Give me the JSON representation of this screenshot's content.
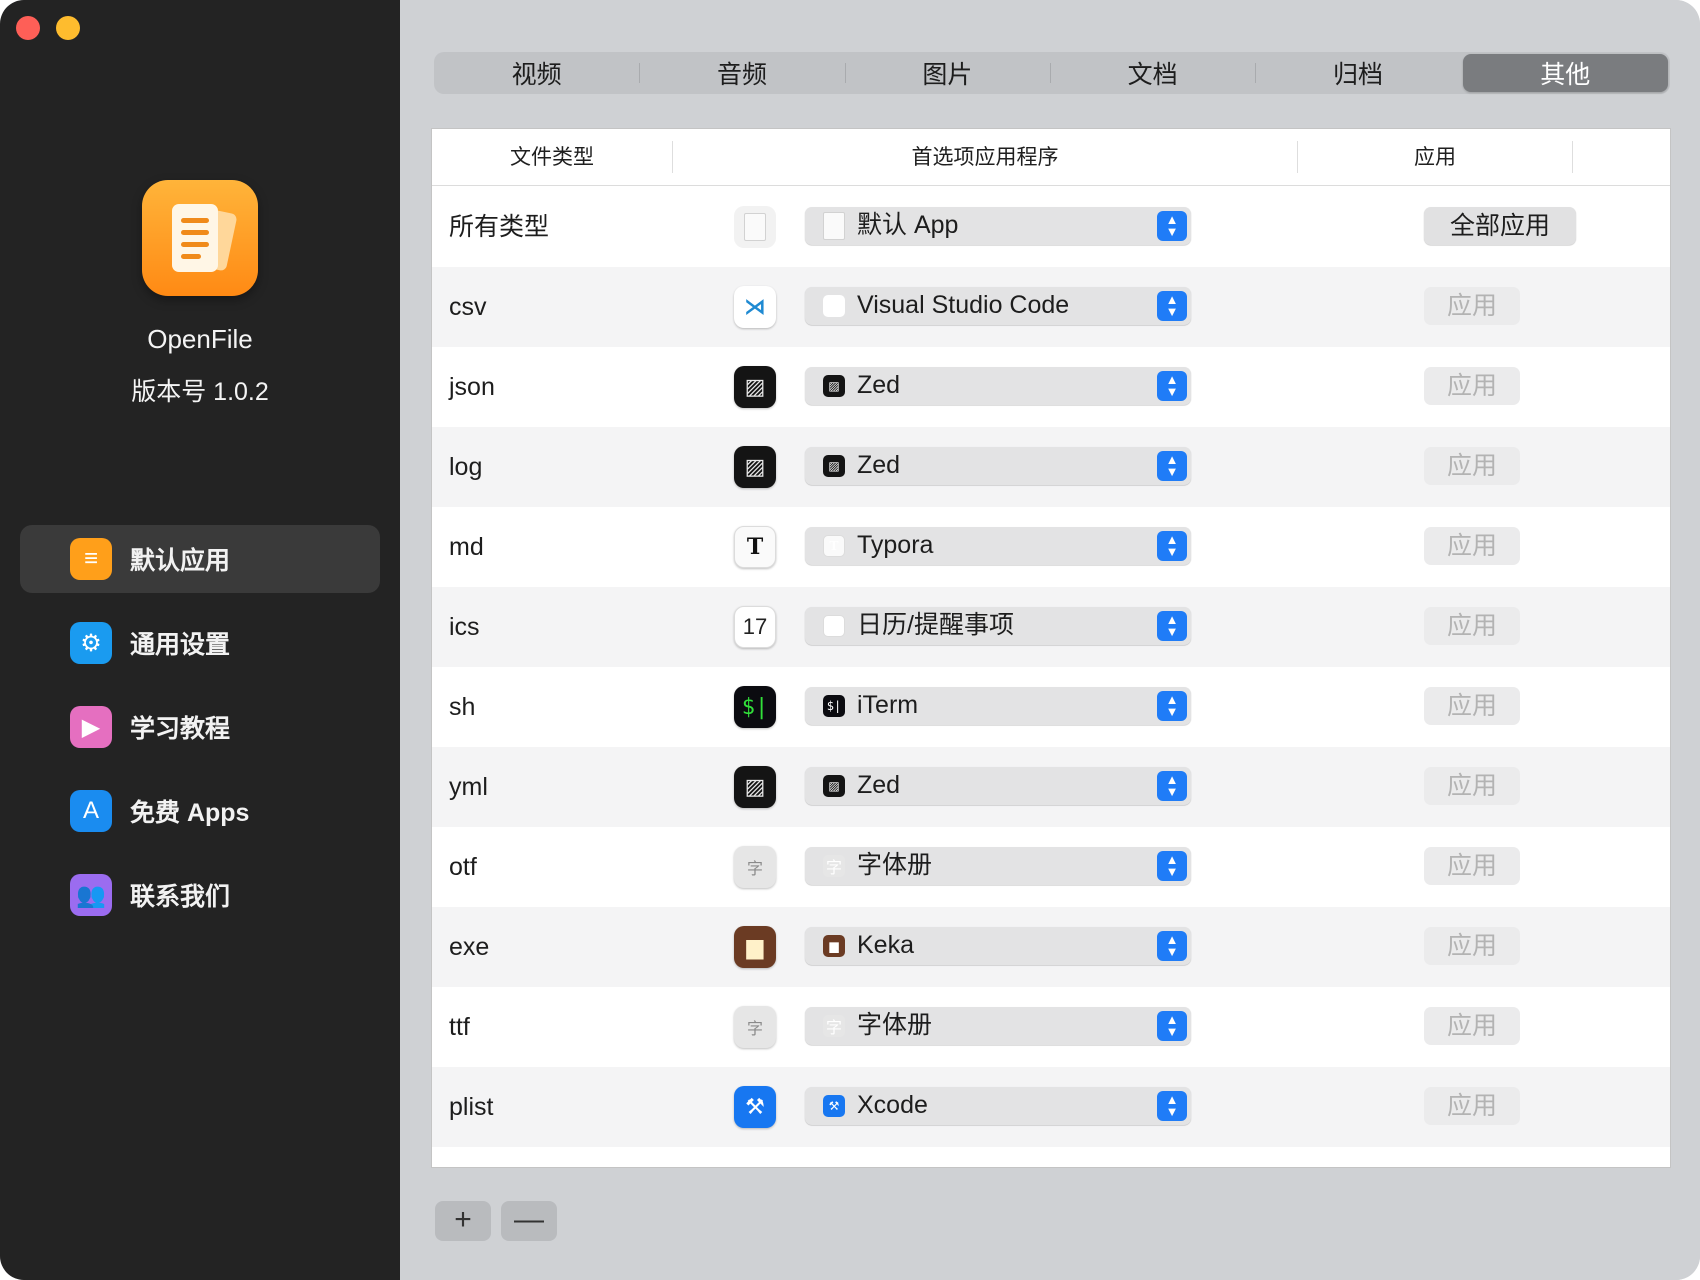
{
  "sidebar": {
    "app_name": "OpenFile",
    "version": "版本号 1.0.2",
    "items": [
      {
        "label": "默认应用",
        "icon": "document-icon",
        "color": "#ff9f1a",
        "glyph": "≡",
        "active": true
      },
      {
        "label": "通用设置",
        "icon": "gear-icon",
        "color": "#1a9bf0",
        "glyph": "⚙",
        "active": false
      },
      {
        "label": "学习教程",
        "icon": "video-icon",
        "color": "#e56fc0",
        "glyph": "▶",
        "active": false
      },
      {
        "label": "免费 Apps",
        "icon": "app-store-icon",
        "color": "#1a8cf0",
        "glyph": "A",
        "active": false
      },
      {
        "label": "联系我们",
        "icon": "people-icon",
        "color": "#9b6cf0",
        "glyph": "👥",
        "active": false
      }
    ]
  },
  "tabs": [
    {
      "label": "视频",
      "active": false
    },
    {
      "label": "音频",
      "active": false
    },
    {
      "label": "图片",
      "active": false
    },
    {
      "label": "文档",
      "active": false
    },
    {
      "label": "归档",
      "active": false
    },
    {
      "label": "其他",
      "active": true
    }
  ],
  "table": {
    "headers": {
      "type": "文件类型",
      "app": "首选项应用程序",
      "apply": "应用"
    },
    "rows": [
      {
        "type": "所有类型",
        "app": "默认 App",
        "icon": "blank-document-icon",
        "icon_class": "ic-blank",
        "glyph": "",
        "action": "全部应用",
        "action_kind": "all"
      },
      {
        "type": "csv",
        "app": "Visual Studio Code",
        "icon": "vscode-icon",
        "icon_class": "ic-vscode",
        "glyph": "⋊",
        "action": "应用",
        "action_kind": "single"
      },
      {
        "type": "json",
        "app": "Zed",
        "icon": "zed-icon",
        "icon_class": "ic-zed",
        "glyph": "▨",
        "action": "应用",
        "action_kind": "single"
      },
      {
        "type": "log",
        "app": "Zed",
        "icon": "zed-icon",
        "icon_class": "ic-zed",
        "glyph": "▨",
        "action": "应用",
        "action_kind": "single"
      },
      {
        "type": "md",
        "app": "Typora",
        "icon": "typora-icon",
        "icon_class": "ic-typora",
        "glyph": "T",
        "action": "应用",
        "action_kind": "single"
      },
      {
        "type": "ics",
        "app": "日历/提醒事项",
        "icon": "calendar-icon",
        "icon_class": "ic-cal",
        "glyph": "17",
        "action": "应用",
        "action_kind": "single"
      },
      {
        "type": "sh",
        "app": "iTerm",
        "icon": "iterm-icon",
        "icon_class": "ic-iterm",
        "glyph": "$|",
        "action": "应用",
        "action_kind": "single"
      },
      {
        "type": "yml",
        "app": "Zed",
        "icon": "zed-icon",
        "icon_class": "ic-zed",
        "glyph": "▨",
        "action": "应用",
        "action_kind": "single"
      },
      {
        "type": "otf",
        "app": "字体册",
        "icon": "font-book-icon",
        "icon_class": "ic-font",
        "glyph": "字",
        "action": "应用",
        "action_kind": "single"
      },
      {
        "type": "exe",
        "app": "Keka",
        "icon": "keka-icon",
        "icon_class": "ic-keka",
        "glyph": "▆",
        "action": "应用",
        "action_kind": "single"
      },
      {
        "type": "ttf",
        "app": "字体册",
        "icon": "font-book-icon",
        "icon_class": "ic-font",
        "glyph": "字",
        "action": "应用",
        "action_kind": "single"
      },
      {
        "type": "plist",
        "app": "Xcode",
        "icon": "xcode-icon",
        "icon_class": "ic-xcode",
        "glyph": "⚒",
        "action": "应用",
        "action_kind": "single"
      }
    ]
  },
  "footer": {
    "add": "+",
    "remove": "—"
  },
  "colors": {
    "accent": "#1f7cf7",
    "sidebar_bg": "#232323",
    "main_bg": "#cfd1d4"
  }
}
